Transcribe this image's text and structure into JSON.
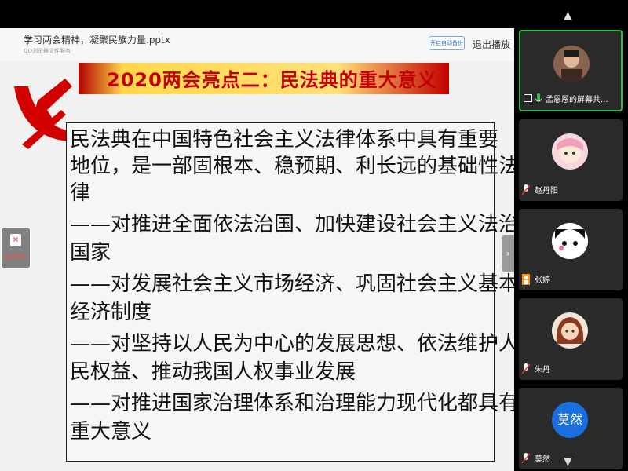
{
  "header": {
    "file_name": "学习两会精神，凝聚民族力量.pptx",
    "file_sub": "QQ浏览器文件服务",
    "backup_button": "开启自动备份",
    "exit_button": "退出播放"
  },
  "slide": {
    "title": "2020两会亮点二：民法典的重大意义",
    "lines": [
      " 民法典在中国特色社会主义法律体系中具有重要",
      "地位，是一部固根本、稳预期、利长远的基础性法",
      "律",
      "——对推进全面依法治国、加快建设社会主义法治",
      "国家",
      "——对发展社会主义市场经济、巩固社会主义基本",
      "经济制度",
      "——对坚持以人民为中心的发展思想、依法维护人",
      "民权益、推动我国人权事业发展",
      "——对推进国家治理体系和治理能力现代化都具有",
      "重大意义"
    ]
  },
  "side_tool": {
    "icon": "close-doc-icon",
    "icon_glyph": "×",
    "label": "退出播放"
  },
  "collapse_button": "›",
  "participants": {
    "scroll_up": "▲",
    "scroll_down": "▼",
    "items": [
      {
        "name": "孟恩恩的屏幕共...",
        "status": "screen-sharing",
        "mic": "unmuted"
      },
      {
        "name": "赵丹阳",
        "status": "",
        "mic": "muted"
      },
      {
        "name": "张婷",
        "status": "",
        "mic": "muted"
      },
      {
        "name": "朱丹",
        "status": "",
        "mic": "muted"
      },
      {
        "name": "莫然",
        "avatar_text": "莫然",
        "status": "",
        "mic": "muted"
      }
    ]
  },
  "colors": {
    "accent_green": "#29c04a",
    "title_red": "#c20000",
    "avatar_blue": "#1a6fe0",
    "muted_red": "#e53935"
  }
}
